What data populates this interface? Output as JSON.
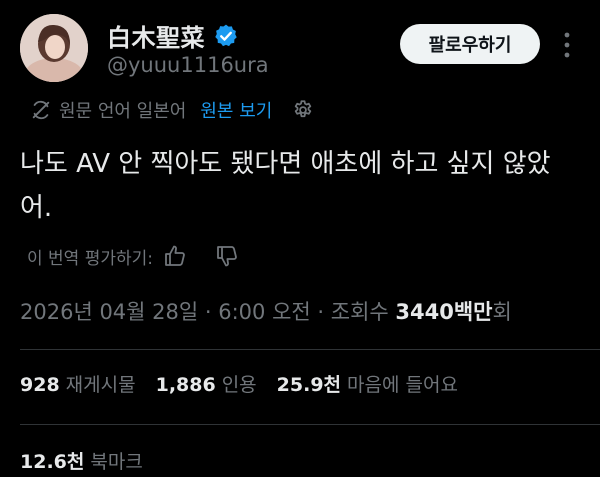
{
  "author": {
    "display_name": "白木聖菜",
    "handle": "@yuuu1116ura",
    "verified_icon": "verified-badge-icon"
  },
  "follow_label": "팔로우하기",
  "translation": {
    "source_label": "원문 언어 일본어",
    "show_original_label": "원본 보기"
  },
  "tweet": {
    "text": "나도 AV 안 찍아도 됐다면 애초에 하고 싶지 않았어."
  },
  "rate": {
    "label": "이 번역 평가하기:"
  },
  "meta": {
    "date": "2026년 04월 28일",
    "time": "6:00 오전",
    "separator": " · ",
    "views_label": "조회수",
    "views_value": "3440백만",
    "views_suffix": "회"
  },
  "stats": [
    {
      "value": "928",
      "label": "재게시물"
    },
    {
      "value": "1,886",
      "label": "인용"
    },
    {
      "value": "25.9천",
      "label": "마음에 들어요"
    }
  ],
  "bookmarks": {
    "value": "12.6천",
    "label": "북마크"
  },
  "colors": {
    "background": "#000000",
    "text": "#e7e9ea",
    "secondary": "#71767b",
    "accent": "#1d9bf0",
    "divider": "#2f3336"
  }
}
